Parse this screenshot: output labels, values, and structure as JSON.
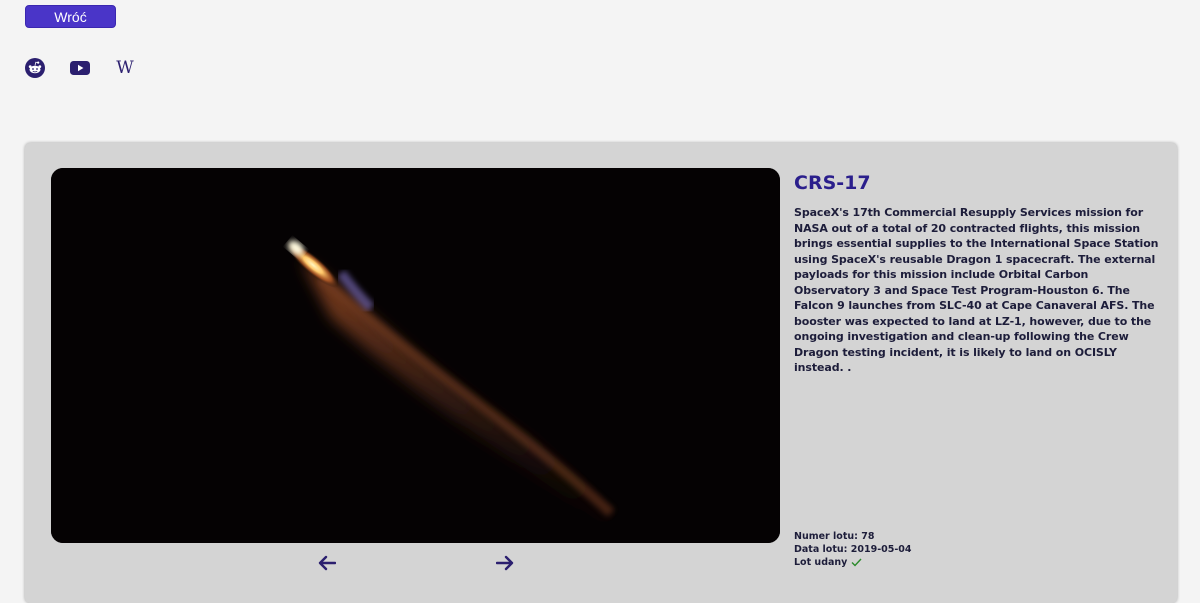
{
  "nav": {
    "back_label": "Wróć"
  },
  "links": [
    {
      "name": "reddit",
      "icon": "reddit-icon"
    },
    {
      "name": "youtube",
      "icon": "youtube-icon"
    },
    {
      "name": "wikipedia",
      "icon": "wikipedia-icon",
      "glyph": "W"
    }
  ],
  "mission": {
    "name": "CRS-17",
    "details": "SpaceX's 17th Commercial Resupply Services mission for NASA out of a total of 20 contracted flights, this mission brings essential supplies to the International Space Station using SpaceX's reusable Dragon 1 spacecraft. The external payloads for this mission include Orbital Carbon Observatory 3 and Space Test Program-Houston 6. The Falcon 9 launches from SLC-40 at Cape Canaveral AFS. The booster was expected to land at LZ-1, however, due to the ongoing investigation and clean-up following the Crew Dragon testing incident, it is likely to land on OCISLY instead. .",
    "flight_number_label": "Numer lotu: 78",
    "flight_date_label": "Data lotu: 2019-05-04",
    "success_label": "Lot udany",
    "success_icon": "check-icon"
  },
  "gallery": {
    "prev_icon": "arrow-left-icon",
    "next_icon": "arrow-right-icon"
  },
  "colors": {
    "accent": "#4a35c8",
    "icon": "#2b1f6f",
    "card_bg": "#d4d4d4",
    "page_bg": "#f4f4f4",
    "success": "#2a8a2a"
  }
}
